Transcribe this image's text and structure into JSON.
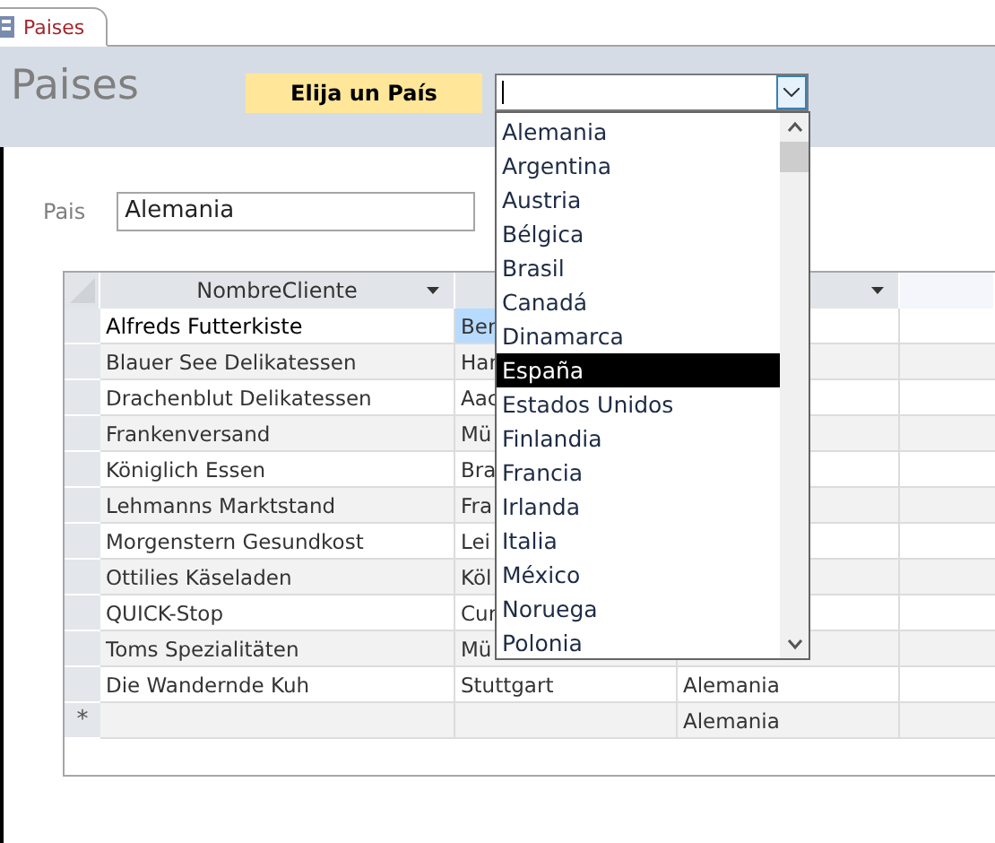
{
  "tab": {
    "label": "Paises",
    "selected": true
  },
  "header": {
    "title": "Paises",
    "prompt": "Elija un País",
    "combo": {
      "expanded": true
    }
  },
  "form": {
    "label": "Pais",
    "value": "Alemania"
  },
  "datasheet": {
    "columns": [
      {
        "label": "NombreCliente"
      }
    ],
    "rows": [
      {
        "column_1": "Alfreds Futterkiste",
        "column_2": "Ber",
        "current": true
      },
      {
        "column_1": "Blauer See Delikatessen",
        "column_2": "Har",
        "current": false
      },
      {
        "column_1": "Drachenblut Delikatessen",
        "column_2": "Aac",
        "current": false
      },
      {
        "column_1": "Frankenversand",
        "column_2": "Mü",
        "current": false
      },
      {
        "column_1": "Königlich Essen",
        "column_2": "Bra",
        "current": false
      },
      {
        "column_1": "Lehmanns Marktstand",
        "column_2": "Fra",
        "current": false
      },
      {
        "column_1": "Morgenstern Gesundkost",
        "column_2": "Lei",
        "current": false
      },
      {
        "column_1": "Ottilies Käseladen",
        "column_2": "Köl",
        "current": false
      },
      {
        "column_1": "QUICK-Stop",
        "column_2": "Cur",
        "current": false
      },
      {
        "column_1": "Toms Spezialitäten",
        "column_2": "Mü",
        "current": false
      },
      {
        "column_1": "Die Wandernde Kuh",
        "column_2": "Stuttgart",
        "column_3": "Alemania",
        "current": false
      }
    ],
    "new_row": {
      "marker": "*",
      "column_3": "Alemania"
    }
  },
  "country_list": [
    {
      "label": "Alemania",
      "selected": false
    },
    {
      "label": "Argentina",
      "selected": false
    },
    {
      "label": "Austria",
      "selected": false
    },
    {
      "label": "Bélgica",
      "selected": false
    },
    {
      "label": "Brasil",
      "selected": false
    },
    {
      "label": "Canadá",
      "selected": false
    },
    {
      "label": "Dinamarca",
      "selected": false
    },
    {
      "label": "España",
      "selected": true
    },
    {
      "label": "Estados Unidos",
      "selected": false
    },
    {
      "label": "Finlandia",
      "selected": false
    },
    {
      "label": "Francia",
      "selected": false
    },
    {
      "label": "Irlanda",
      "selected": false
    },
    {
      "label": "Italia",
      "selected": false
    },
    {
      "label": "México",
      "selected": false
    },
    {
      "label": "Noruega",
      "selected": false
    },
    {
      "label": "Polonia",
      "selected": false
    }
  ]
}
